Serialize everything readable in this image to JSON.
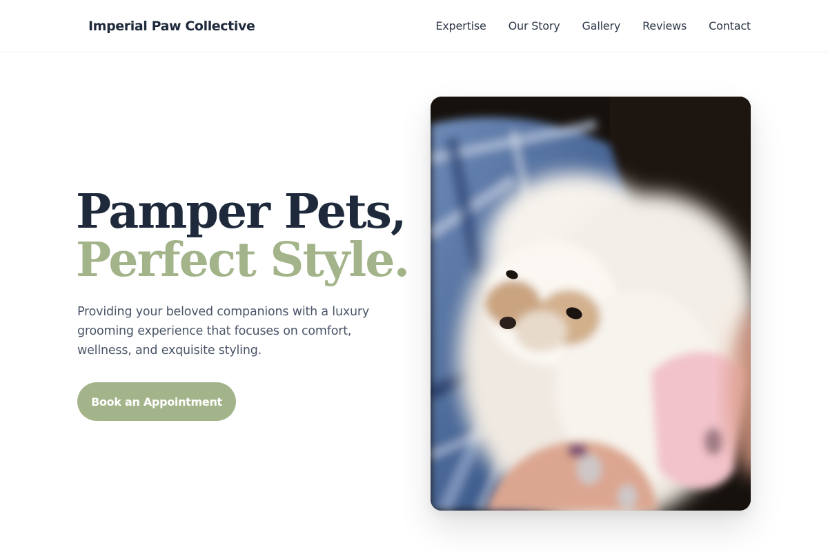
{
  "brand": {
    "name": "Imperial Paw Collective"
  },
  "nav": {
    "links": [
      {
        "label": "Expertise"
      },
      {
        "label": "Our Story"
      },
      {
        "label": "Gallery"
      },
      {
        "label": "Reviews"
      },
      {
        "label": "Contact"
      }
    ]
  },
  "hero": {
    "title_line1": "Pamper Pets,",
    "title_line2": "Perfect Style.",
    "description": "Providing your beloved companions with a luxury grooming experience that focuses on comfort, wellness, and exquisite styling.",
    "cta_label": "Book an Appointment",
    "image_subject": "fluffy-white-dog-photo"
  },
  "colors": {
    "primary_text": "#1e2a3b",
    "accent_sage": "#a4b48a",
    "body_text": "#4a5568",
    "button_text": "#ffffff"
  }
}
